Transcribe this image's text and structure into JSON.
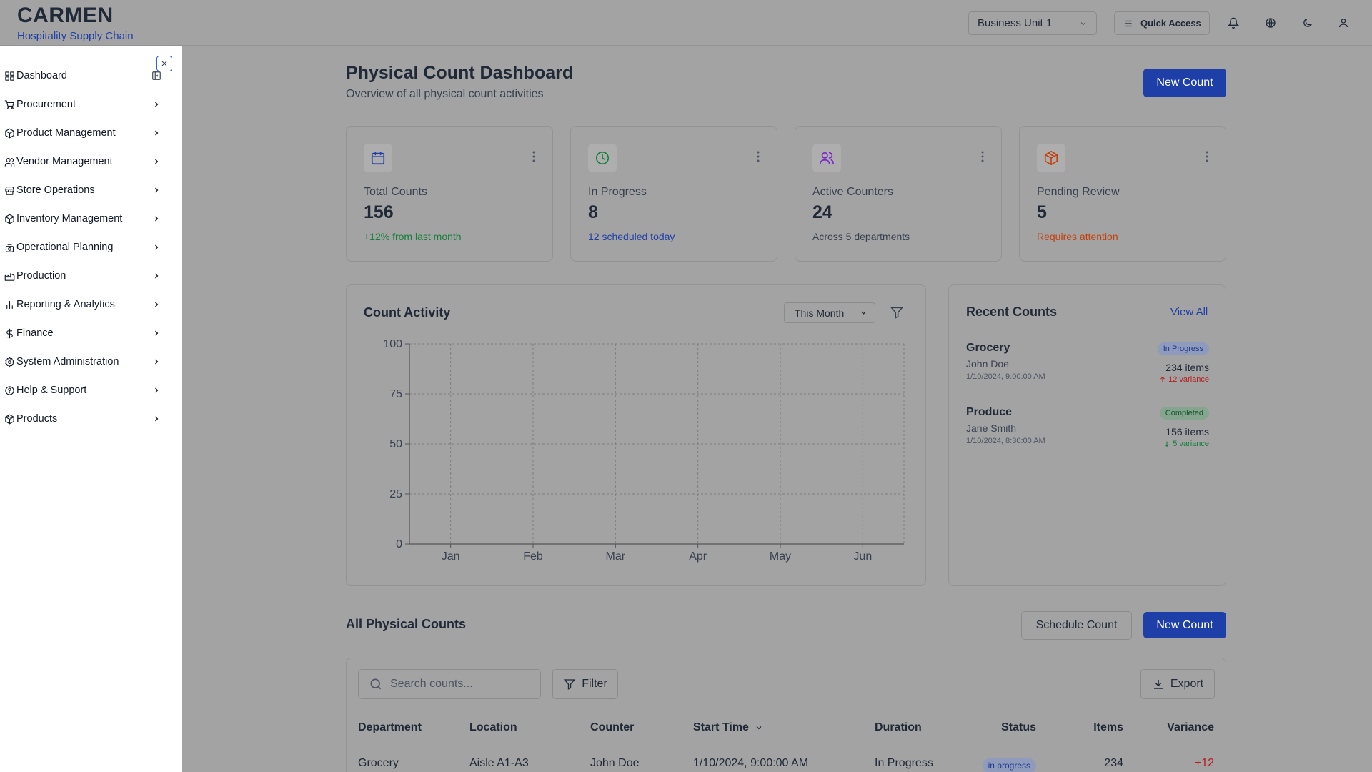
{
  "brand": {
    "title": "CARMEN",
    "subtitle": "Hospitality Supply Chain"
  },
  "header": {
    "business_unit": "Business Unit 1",
    "quick_access": "Quick Access"
  },
  "sidebar": {
    "items": [
      {
        "label": "Dashboard",
        "icon": "grid-icon"
      },
      {
        "label": "Procurement",
        "icon": "cart-icon"
      },
      {
        "label": "Product Management",
        "icon": "package-icon"
      },
      {
        "label": "Vendor Management",
        "icon": "users-icon"
      },
      {
        "label": "Store Operations",
        "icon": "store-icon"
      },
      {
        "label": "Inventory Management",
        "icon": "package-icon"
      },
      {
        "label": "Operational Planning",
        "icon": "chef-icon"
      },
      {
        "label": "Production",
        "icon": "factory-icon"
      },
      {
        "label": "Reporting & Analytics",
        "icon": "bar-chart-icon"
      },
      {
        "label": "Finance",
        "icon": "dollar-icon"
      },
      {
        "label": "System Administration",
        "icon": "gear-icon"
      },
      {
        "label": "Help & Support",
        "icon": "help-icon"
      },
      {
        "label": "Products",
        "icon": "box-icon"
      }
    ]
  },
  "page": {
    "title": "Physical Count Dashboard",
    "subtitle": "Overview of all physical count activities",
    "new_count": "New Count"
  },
  "stats": [
    {
      "label": "Total Counts",
      "value": "156",
      "foot": "+12% from last month",
      "icon": "calendar-icon",
      "color": "#1e3fa8",
      "foot_color": "#15803d"
    },
    {
      "label": "In Progress",
      "value": "8",
      "foot": "12 scheduled today",
      "icon": "clock-icon",
      "color": "#15803d",
      "foot_color": "#1e3fa8"
    },
    {
      "label": "Active Counters",
      "value": "24",
      "foot": "Across 5 departments",
      "icon": "users-icon",
      "color": "#7e22ce",
      "foot_color": "#374151"
    },
    {
      "label": "Pending Review",
      "value": "5",
      "foot": "Requires attention",
      "icon": "box-icon",
      "color": "#c2410c",
      "foot_color": "#c2410c"
    }
  ],
  "activity": {
    "title": "Count Activity",
    "period": "This Month"
  },
  "chart_data": {
    "type": "line",
    "categories": [
      "Jan",
      "Feb",
      "Mar",
      "Apr",
      "May",
      "Jun"
    ],
    "series": [],
    "yticks": [
      0,
      25,
      50,
      75,
      100
    ],
    "ylim": [
      0,
      100
    ],
    "grid": true
  },
  "recent": {
    "title": "Recent Counts",
    "view_all": "View All",
    "items": [
      {
        "name": "Grocery",
        "person": "John Doe",
        "time": "1/10/2024, 9:00:00 AM",
        "status": "In Progress",
        "items": "234 items",
        "variance": "12 variance",
        "direction": "up"
      },
      {
        "name": "Produce",
        "person": "Jane Smith",
        "time": "1/10/2024, 8:30:00 AM",
        "status": "Completed",
        "items": "156 items",
        "variance": "5 variance",
        "direction": "down"
      }
    ]
  },
  "all_counts": {
    "title": "All Physical Counts",
    "schedule": "Schedule Count",
    "new_count": "New Count",
    "search_placeholder": "Search counts...",
    "filter": "Filter",
    "export": "Export",
    "columns": [
      "Department",
      "Location",
      "Counter",
      "Start Time",
      "Duration",
      "Status",
      "Items",
      "Variance"
    ],
    "rows": [
      {
        "department": "Grocery",
        "location": "Aisle A1-A3",
        "counter": "John Doe",
        "start": "1/10/2024, 9:00:00 AM",
        "duration": "In Progress",
        "status": "in progress",
        "items": "234",
        "variance": "+12"
      }
    ]
  }
}
